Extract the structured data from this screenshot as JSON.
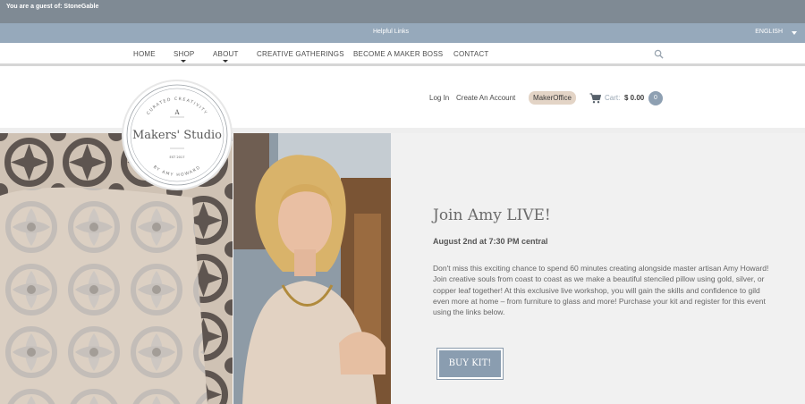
{
  "guest_bar": {
    "text": "You are a guest of: StoneGable"
  },
  "helpful_bar": {
    "label": "Helpful Links",
    "language": "ENGLISH"
  },
  "nav": {
    "items": [
      "HOME",
      "SHOP",
      "ABOUT",
      "CREATIVE GATHERINGS",
      "BECOME A MAKER BOSS",
      "CONTACT"
    ]
  },
  "header": {
    "login": "Log In",
    "create_account": "Create An Account",
    "maker_office": "MakerOffice",
    "cart_label": "Cart:",
    "cart_amount": "$ 0.00",
    "cart_count": "0"
  },
  "logo": {
    "top_arc": "CURATED CREATIVITY",
    "letter": "A",
    "name": "Makers' Studio",
    "est": "EST 2017",
    "bottom_arc": "BY AMY HOWARD"
  },
  "event": {
    "title": "Join Amy LIVE!",
    "date": "August 2nd at 7:30 PM central",
    "description": "Don't miss this exciting chance to spend 60 minutes creating alongside master artisan Amy Howard! Join creative souls from coast to coast as we make a beautiful stenciled pillow using gold, silver, or copper leaf together! At this exclusive live workshop, you will gain the skills and confidence to gild even more at home – from furniture to glass and more! Purchase your kit and register for this event using the links below.",
    "button": "BUY KIT!"
  },
  "colors": {
    "guest_bar": "#7f8a94",
    "helpful_bar": "#96a9bb",
    "accent": "#8a9db0",
    "maker_office_pill": "#e3d4c6"
  }
}
